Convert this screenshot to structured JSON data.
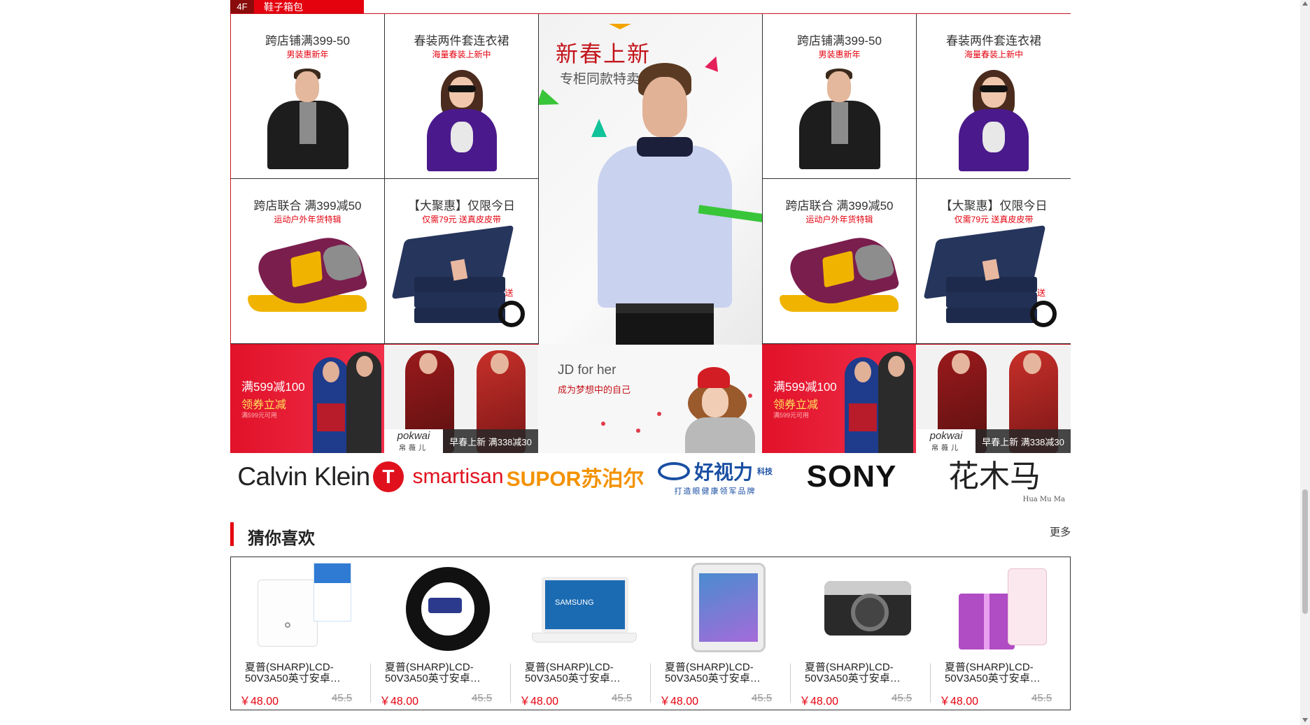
{
  "floor": {
    "number": "4F",
    "name": "鞋子箱包"
  },
  "grid_cells": [
    {
      "title": "跨店铺满399-50",
      "subtitle": "男装惠新年",
      "kind": "man"
    },
    {
      "title": "春装两件套连衣裙",
      "subtitle": "海量春装上新中",
      "kind": "woman"
    },
    {
      "title": "跨店联合 满399减50",
      "subtitle": "运动户外年货特辑",
      "kind": "shoe"
    },
    {
      "title": "【大聚惠】仅限今日",
      "subtitle": "仅需79元 送真皮皮带",
      "kind": "jeans",
      "gift": "送"
    },
    {
      "title": "跨店铺满399-50",
      "subtitle": "男装惠新年",
      "kind": "man"
    },
    {
      "title": "春装两件套连衣裙",
      "subtitle": "海量春装上新中",
      "kind": "woman"
    },
    {
      "title": "跨店联合 满399减50",
      "subtitle": "运动户外年货特辑",
      "kind": "shoe"
    },
    {
      "title": "【大聚惠】仅限今日",
      "subtitle": "仅需79元 送真皮皮带",
      "kind": "jeans",
      "gift": "送"
    }
  ],
  "center_banner": {
    "title": "新春上新",
    "subtitle": "专柜同款特卖"
  },
  "banners": {
    "red": {
      "line1": "满599减100",
      "line2": "领券立减",
      "line3": "满599元可用"
    },
    "dress": {
      "logo_en": "pokwai",
      "logo_cn": "帛薇儿",
      "promo": "早春上新 满338减30"
    },
    "jd": {
      "title": "JD for her",
      "subtitle": "成为梦想中的自己"
    }
  },
  "brands": {
    "ck": "Calvin Klein",
    "ck_badge": "T",
    "smartisan": "smartisan",
    "supor": "SUPOR苏泊尔",
    "hsl_name": "好视力",
    "hsl_small": "科技",
    "hsl_tagline": "打造眼健康领军品牌",
    "sony": "SONY",
    "hmm": "花木马",
    "hmm_en": "Hua Mu Ma"
  },
  "guess": {
    "title": "猜你喜欢",
    "more": "更多",
    "items": [
      {
        "name": "夏普(SHARP)LCD-50V3A50英寸安卓…",
        "price": "￥48.00",
        "old_price": "45.5",
        "kind": "router"
      },
      {
        "name": "夏普(SHARP)LCD-50V3A50英寸安卓…",
        "price": "￥48.00",
        "old_price": "45.5",
        "kind": "band"
      },
      {
        "name": "夏普(SHARP)LCD-50V3A50英寸安卓…",
        "price": "￥48.00",
        "old_price": "45.5",
        "kind": "laptop",
        "label": "SAMSUNG"
      },
      {
        "name": "夏普(SHARP)LCD-50V3A50英寸安卓…",
        "price": "￥48.00",
        "old_price": "45.5",
        "kind": "tablet"
      },
      {
        "name": "夏普(SHARP)LCD-50V3A50英寸安卓…",
        "price": "￥48.00",
        "old_price": "45.5",
        "kind": "camera"
      },
      {
        "name": "夏普(SHARP)LCD-50V3A50英寸安卓…",
        "price": "￥48.00",
        "old_price": "45.5",
        "kind": "perfume"
      }
    ]
  },
  "colors": {
    "accent": "#e4020f",
    "dark_red": "#8a0b0b"
  }
}
